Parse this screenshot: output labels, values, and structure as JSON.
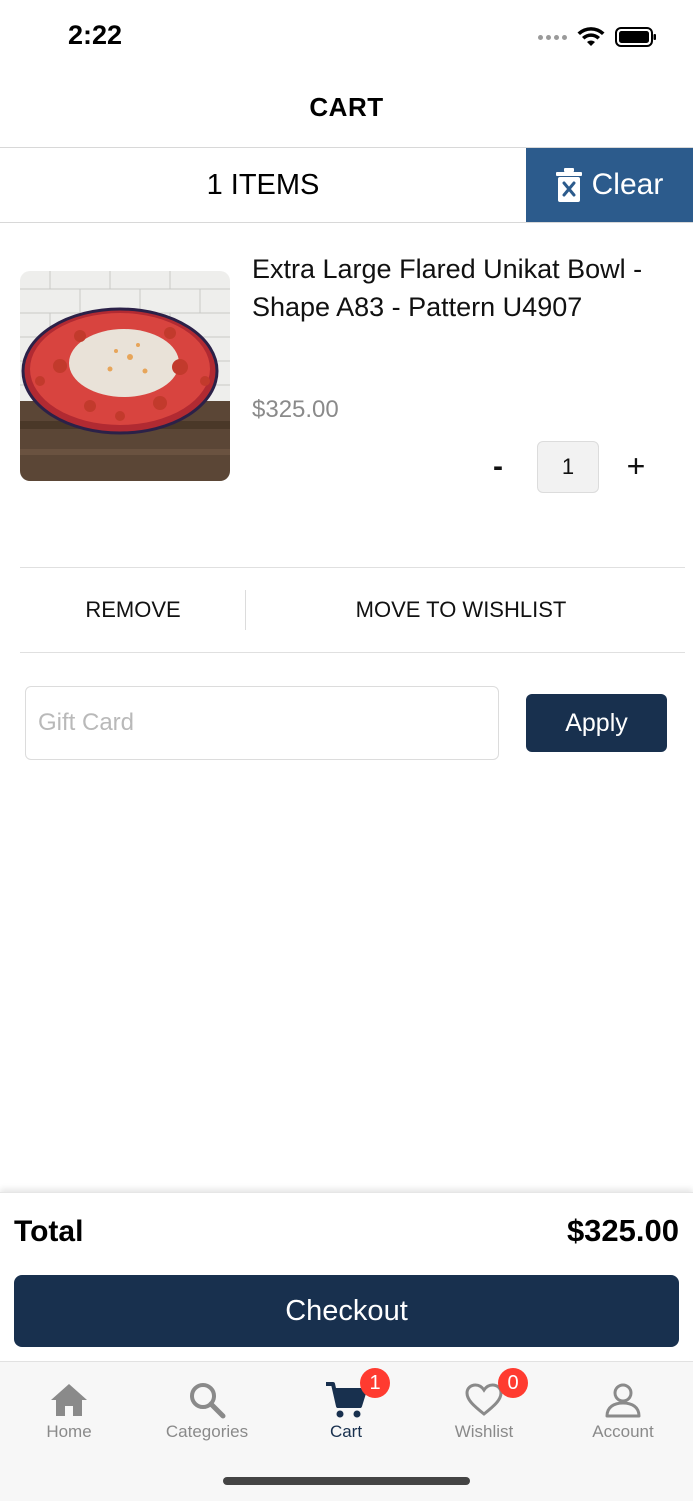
{
  "status": {
    "time": "2:22"
  },
  "header": {
    "title": "CART"
  },
  "cart_bar": {
    "items_count_label": "1 ITEMS",
    "clear_label": "Clear",
    "clear_color": "#2c5b8c"
  },
  "product": {
    "title": "Extra Large Flared Unikat Bowl - Shape A83 - Pattern U4907",
    "price": "$325.00",
    "quantity": "1",
    "minus_label": "-",
    "plus_label": "+"
  },
  "actions": {
    "remove_label": "REMOVE",
    "move_to_wishlist_label": "MOVE TO WISHLIST"
  },
  "gift_card": {
    "placeholder": "Gift Card",
    "value": "",
    "apply_label": "Apply"
  },
  "totals": {
    "label": "Total",
    "value": "$325.00",
    "checkout_label": "Checkout",
    "button_color": "#18304e"
  },
  "tab_bar": {
    "tabs": [
      {
        "label": "Home",
        "icon": "home-icon",
        "active": false
      },
      {
        "label": "Categories",
        "icon": "search-icon",
        "active": false
      },
      {
        "label": "Cart",
        "icon": "cart-icon",
        "active": true,
        "badge": "1"
      },
      {
        "label": "Wishlist",
        "icon": "heart-icon",
        "active": false,
        "badge": "0"
      },
      {
        "label": "Account",
        "icon": "person-icon",
        "active": false
      }
    ]
  }
}
